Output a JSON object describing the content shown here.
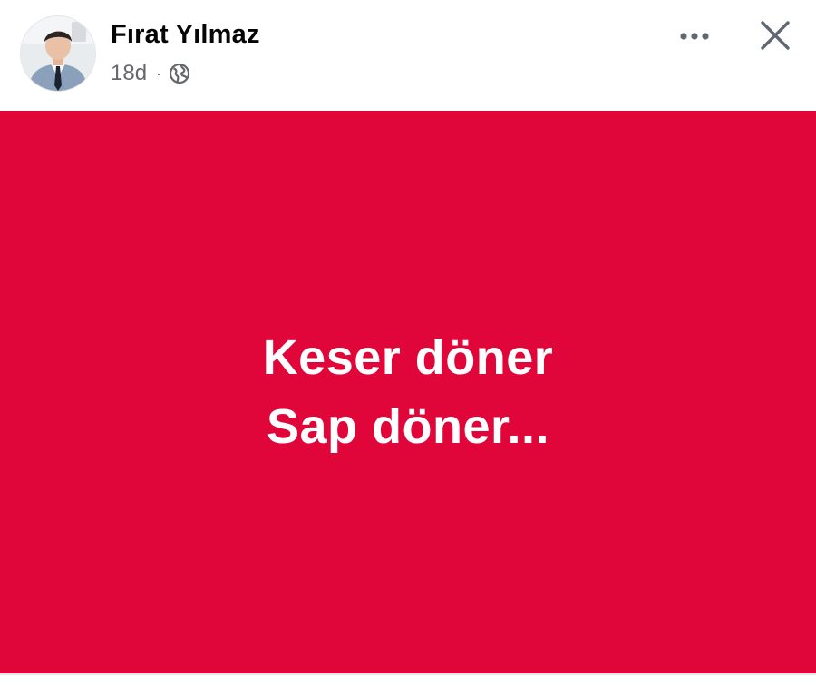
{
  "post": {
    "author": "Fırat Yılmaz",
    "timestamp": "18d",
    "separator": "·",
    "privacy_icon": "globe-icon",
    "more_icon": "more-dots-icon",
    "close_icon": "close-icon",
    "body_lines": [
      "Keser döner",
      "Sap döner..."
    ],
    "background_color": "#e1063a",
    "text_color": "#ffffff"
  },
  "colors": {
    "name": "#050505",
    "meta": "#65676b",
    "icon": "#606770"
  }
}
